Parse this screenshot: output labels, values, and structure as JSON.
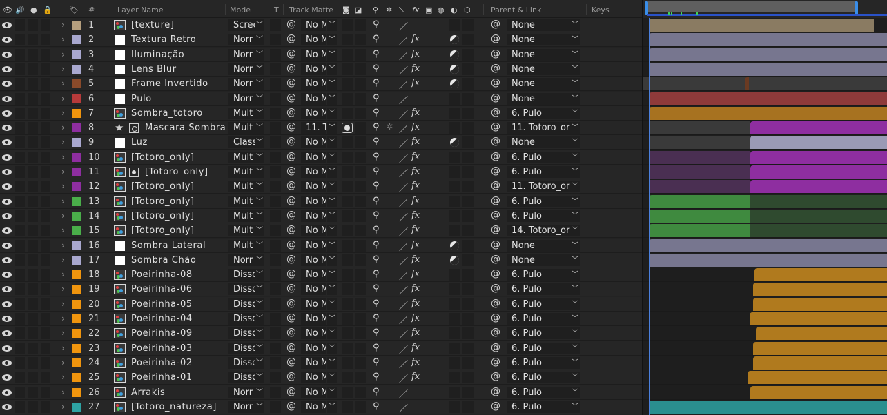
{
  "header": {
    "hash": "#",
    "layer_name": "Layer Name",
    "mode": "Mode",
    "t": "T",
    "track_matte": "Track Matte",
    "parent_link": "Parent & Link",
    "keys": "Keys"
  },
  "colors": {
    "tan": "#b59f7e",
    "lavender": "#a9a8cf",
    "brown": "#8a4a2a",
    "red": "#b63a3a",
    "orange": "#f0950e",
    "purple": "#8e2ea0",
    "green": "#4aae4a",
    "teal": "#2ea3a3",
    "white": "#ffffff"
  },
  "layers": [
    {
      "num": "1",
      "name": "[texture]",
      "label": "tan",
      "src": "footage",
      "mode": "Scree",
      "matte": "No M",
      "fx": false,
      "adj": false,
      "parent": "None"
    },
    {
      "num": "2",
      "name": "Textura Retro",
      "label": "lavender",
      "src": "solid",
      "mode": "Norr",
      "matte": "No M",
      "fx": true,
      "adj": true,
      "parent": "None"
    },
    {
      "num": "3",
      "name": "Iluminação",
      "label": "lavender",
      "src": "solid",
      "mode": "Norr",
      "matte": "No M",
      "fx": true,
      "adj": true,
      "parent": "None"
    },
    {
      "num": "4",
      "name": "Lens Blur",
      "label": "lavender",
      "src": "solid",
      "mode": "Norr",
      "matte": "No M",
      "fx": true,
      "adj": true,
      "parent": "None"
    },
    {
      "num": "5",
      "name": "Frame Invertido",
      "label": "brown",
      "src": "solid",
      "mode": "Norr",
      "matte": "No M",
      "fx": true,
      "adj": true,
      "parent": "None"
    },
    {
      "num": "6",
      "name": "Pulo",
      "label": "red",
      "src": "solid",
      "mode": "Norr",
      "matte": "No M",
      "fx": false,
      "adj": false,
      "parent": "None"
    },
    {
      "num": "7",
      "name": "Sombra_totoro",
      "label": "orange",
      "src": "footage",
      "mode": "Mult",
      "matte": "No M",
      "fx": true,
      "adj": false,
      "parent": "6. Pulo"
    },
    {
      "num": "8",
      "name": "Mascara Sombra",
      "label": "purple",
      "src": "shape",
      "mode": "Mult",
      "matte": "11. T",
      "fx": true,
      "adj": false,
      "parent": "11. Totoro_or"
    },
    {
      "num": "9",
      "name": "Luz",
      "label": "lavender",
      "src": "solid",
      "mode": "Class",
      "matte": "No M",
      "fx": true,
      "adj": true,
      "parent": "None"
    },
    {
      "num": "10",
      "name": "[Totoro_only]",
      "label": "purple",
      "src": "footage",
      "mode": "Mult",
      "matte": "No M",
      "fx": true,
      "adj": false,
      "parent": "6. Pulo"
    },
    {
      "num": "11",
      "name": "[Totoro_only]",
      "label": "purple",
      "src": "footage-null",
      "mode": "Mult",
      "matte": "No M",
      "fx": true,
      "adj": false,
      "parent": "6. Pulo"
    },
    {
      "num": "12",
      "name": "[Totoro_only]",
      "label": "purple",
      "src": "footage",
      "mode": "Mult",
      "matte": "No M",
      "fx": true,
      "adj": false,
      "parent": "11. Totoro_or"
    },
    {
      "num": "13",
      "name": "[Totoro_only]",
      "label": "green",
      "src": "footage",
      "mode": "Mult",
      "matte": "No M",
      "fx": true,
      "adj": false,
      "parent": "6. Pulo"
    },
    {
      "num": "14",
      "name": "[Totoro_only]",
      "label": "green",
      "src": "footage",
      "mode": "Mult",
      "matte": "No M",
      "fx": true,
      "adj": false,
      "parent": "6. Pulo"
    },
    {
      "num": "15",
      "name": "[Totoro_only]",
      "label": "green",
      "src": "footage",
      "mode": "Mult",
      "matte": "No M",
      "fx": true,
      "adj": false,
      "parent": "14. Totoro_or"
    },
    {
      "num": "16",
      "name": "Sombra Lateral",
      "label": "lavender",
      "src": "solid",
      "mode": "Mult",
      "matte": "No M",
      "fx": true,
      "adj": true,
      "parent": "None"
    },
    {
      "num": "17",
      "name": "Sombra Chão",
      "label": "lavender",
      "src": "solid",
      "mode": "Norr",
      "matte": "No M",
      "fx": true,
      "adj": true,
      "parent": "None"
    },
    {
      "num": "18",
      "name": "Poeirinha-08",
      "label": "orange",
      "src": "footage",
      "mode": "Disso",
      "matte": "No M",
      "fx": true,
      "adj": false,
      "parent": "6. Pulo"
    },
    {
      "num": "19",
      "name": "Poeirinha-06",
      "label": "orange",
      "src": "footage",
      "mode": "Disso",
      "matte": "No M",
      "fx": true,
      "adj": false,
      "parent": "6. Pulo"
    },
    {
      "num": "20",
      "name": "Poeirinha-05",
      "label": "orange",
      "src": "footage",
      "mode": "Disso",
      "matte": "No M",
      "fx": true,
      "adj": false,
      "parent": "6. Pulo"
    },
    {
      "num": "21",
      "name": "Poeirinha-04",
      "label": "orange",
      "src": "footage",
      "mode": "Disso",
      "matte": "No M",
      "fx": true,
      "adj": false,
      "parent": "6. Pulo"
    },
    {
      "num": "22",
      "name": "Poeirinha-09",
      "label": "orange",
      "src": "footage",
      "mode": "Disso",
      "matte": "No M",
      "fx": true,
      "adj": false,
      "parent": "6. Pulo"
    },
    {
      "num": "23",
      "name": "Poeirinha-03",
      "label": "orange",
      "src": "footage",
      "mode": "Disso",
      "matte": "No M",
      "fx": true,
      "adj": false,
      "parent": "6. Pulo"
    },
    {
      "num": "24",
      "name": "Poeirinha-02",
      "label": "orange",
      "src": "footage",
      "mode": "Disso",
      "matte": "No M",
      "fx": true,
      "adj": false,
      "parent": "6. Pulo"
    },
    {
      "num": "25",
      "name": "Poeirinha-01",
      "label": "orange",
      "src": "footage",
      "mode": "Disso",
      "matte": "No M",
      "fx": true,
      "adj": false,
      "parent": "6. Pulo"
    },
    {
      "num": "26",
      "name": "Arrakis",
      "label": "orange",
      "src": "footage",
      "mode": "Norr",
      "matte": "No M",
      "fx": false,
      "adj": false,
      "parent": "6. Pulo"
    },
    {
      "num": "27",
      "name": "[Totoro_natureza]",
      "label": "teal",
      "src": "footage",
      "mode": "Norr",
      "matte": "No M",
      "fx": false,
      "adj": false,
      "parent": "6. Pulo"
    }
  ]
}
